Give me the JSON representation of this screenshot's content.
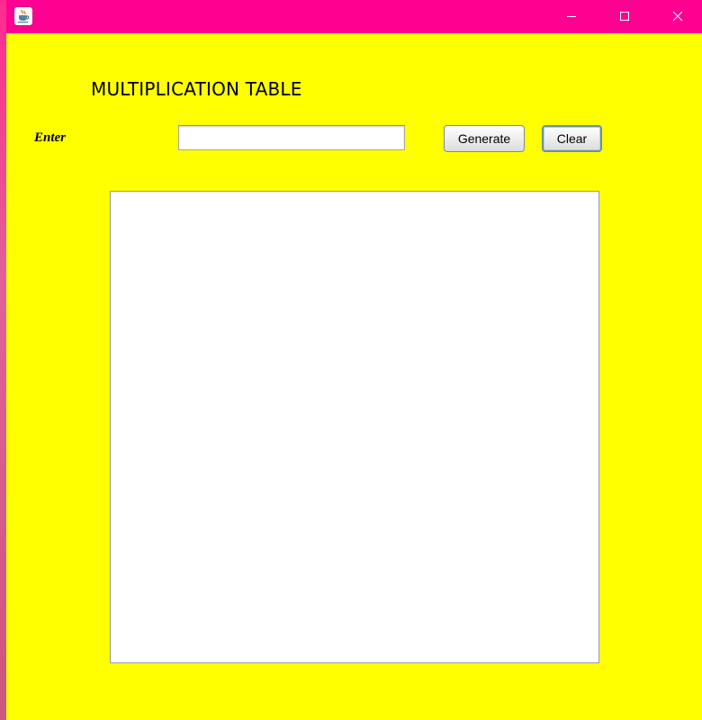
{
  "window": {
    "title": "",
    "titlebar_color": "#ff0090",
    "background_color": "#ffff00",
    "icons": {
      "app": "java-coffee-cup-icon",
      "minimize": "minimize-icon",
      "maximize": "maximize-icon",
      "close": "close-icon"
    }
  },
  "main": {
    "heading": "MULTIPLICATION TABLE",
    "enter_label": "Enter",
    "input_value": "",
    "input_placeholder": "",
    "generate_label": "Generate",
    "clear_label": "Clear",
    "output_text": ""
  }
}
